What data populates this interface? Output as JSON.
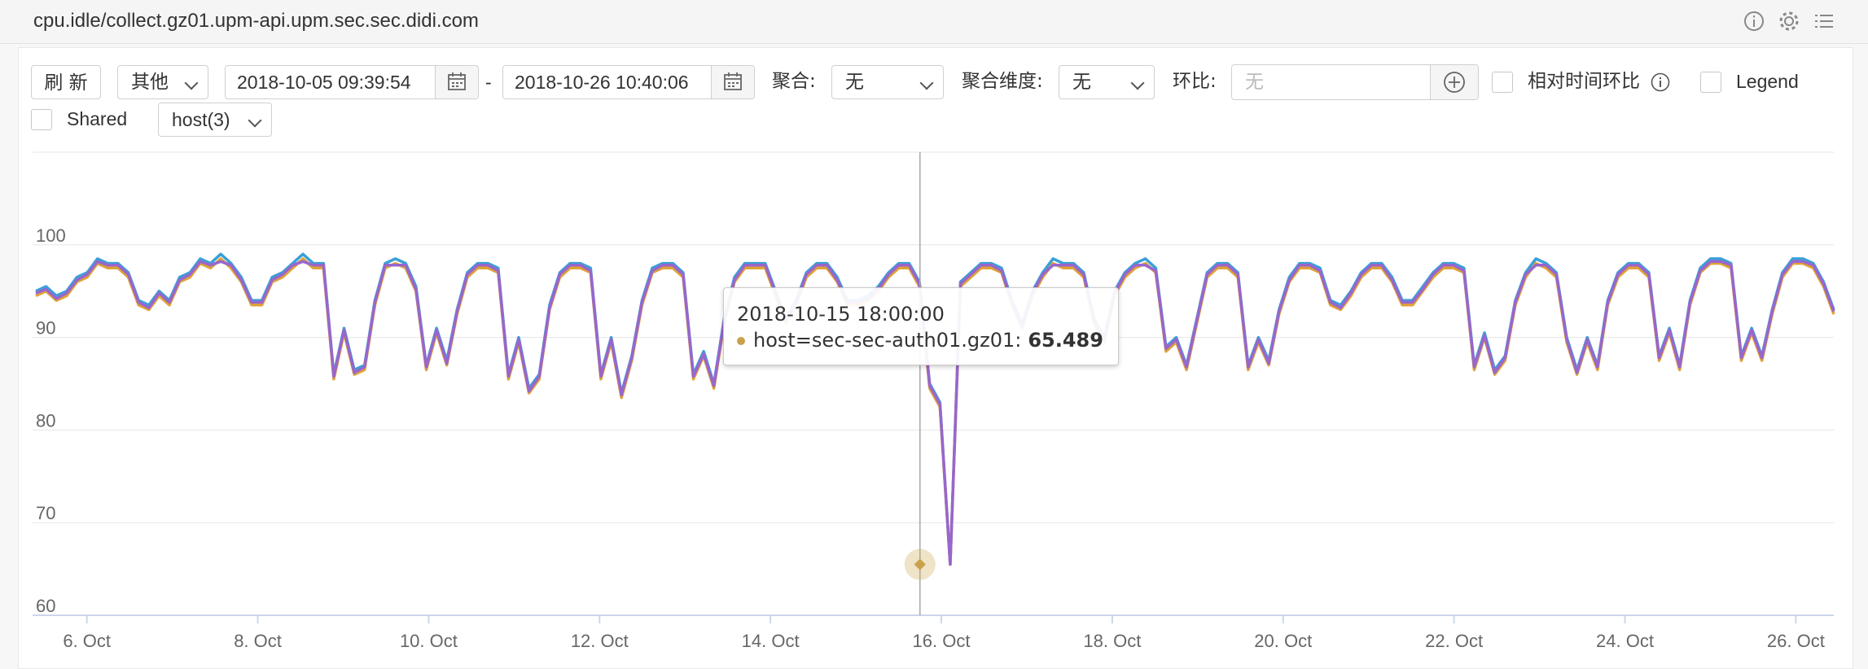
{
  "header": {
    "title": "cpu.idle/collect.gz01.upm-api.upm.sec.sec.didi.com",
    "icons": [
      "info-icon",
      "gear-icon",
      "list-icon"
    ]
  },
  "toolbar": {
    "refresh_label": "刷 新",
    "other_label": "其他",
    "start_date": "2018-10-05 09:39:54",
    "dash": "-",
    "end_date": "2018-10-26 10:40:06",
    "aggregate_label": "聚合:",
    "aggregate_value": "无",
    "dimension_label": "聚合维度:",
    "dimension_value": "无",
    "compare_label": "环比:",
    "compare_placeholder": "无",
    "relative_label": "相对时间环比",
    "legend_label": "Legend",
    "shared_label": "Shared",
    "host_value": "host(3)"
  },
  "tooltip": {
    "time": "2018-10-15 18:00:00",
    "series": "host=sec-sec-auth01.gz01:",
    "value": "65.489",
    "color": "#c9a14a"
  },
  "chart_data": {
    "type": "line",
    "xlabel": "",
    "ylabel": "",
    "ylim": [
      60,
      110
    ],
    "y_ticks": [
      60,
      70,
      80,
      90,
      100
    ],
    "x_range": [
      "2018-10-05 09:39:54",
      "2018-10-26 10:40:06"
    ],
    "x_ticks": [
      "6. Oct",
      "8. Oct",
      "10. Oct",
      "12. Oct",
      "14. Oct",
      "16. Oct",
      "18. Oct",
      "20. Oct",
      "22. Oct",
      "24. Oct",
      "26. Oct"
    ],
    "grid": true,
    "legend": "hidden",
    "colors": [
      "#3aa0d8",
      "#e0a236",
      "#9966cc"
    ],
    "series": [
      {
        "values": [
          95,
          95.5,
          94.5,
          95,
          96.5,
          97,
          98.5,
          98,
          98,
          97,
          94,
          93.5,
          95,
          94,
          96.5,
          97,
          98.5,
          98,
          99,
          98,
          96.5,
          94,
          94,
          96.5,
          97,
          98,
          99,
          98,
          98,
          86,
          91,
          86.5,
          87,
          94,
          98,
          98.5,
          98,
          95.5,
          87,
          91,
          87.5,
          93,
          97,
          98,
          98,
          97.5,
          86,
          90,
          84.5,
          86,
          93.5,
          97,
          98,
          98,
          97.5,
          86,
          90,
          84,
          88,
          94,
          97.5,
          98,
          98,
          97,
          86,
          88.5,
          85,
          92,
          96.5,
          98,
          98,
          98,
          95,
          92,
          94,
          97,
          98,
          98,
          96.5,
          94,
          94,
          94.5,
          95.5,
          97,
          98,
          98,
          96,
          85,
          83,
          65.5,
          96,
          97,
          98,
          98,
          97.5,
          94,
          91.5,
          95,
          97,
          98.5,
          98,
          98,
          97,
          92,
          90,
          95,
          97,
          98,
          98.5,
          97.5,
          89,
          90,
          87,
          92,
          97,
          98,
          98,
          97,
          87,
          90,
          87.5,
          93,
          96.5,
          98,
          98,
          97.5,
          94,
          93.5,
          95,
          97,
          98,
          98,
          96.5,
          94,
          94,
          95.5,
          97,
          98,
          98,
          97.5,
          87,
          90.5,
          86.5,
          88,
          94,
          97,
          98.5,
          98,
          97,
          90,
          86.5,
          90,
          87,
          94,
          97,
          98,
          98,
          97,
          88,
          91,
          87,
          94,
          97.5,
          98.5,
          98.5,
          98,
          88,
          91,
          88,
          93,
          97,
          98.5,
          98.5,
          98,
          96,
          93
        ]
      },
      {
        "values": [
          94.5,
          95,
          94,
          94.5,
          96,
          96.5,
          98,
          97.5,
          97.5,
          96.5,
          93.5,
          93,
          94.5,
          93.5,
          96,
          96.5,
          98,
          97.5,
          98.5,
          97.5,
          96,
          93.5,
          93.5,
          96,
          96.5,
          97.5,
          98.5,
          97.5,
          97.5,
          85.5,
          90.5,
          86,
          86.5,
          93.5,
          97.5,
          98,
          97.5,
          95,
          86.5,
          90.5,
          87,
          92.5,
          96.5,
          97.5,
          97.5,
          97,
          85.5,
          89.5,
          84,
          85.5,
          93,
          96.5,
          97.5,
          97.5,
          97,
          85.5,
          89.5,
          83.5,
          87.5,
          93.5,
          97,
          97.5,
          97.5,
          96.5,
          85.5,
          88,
          84.5,
          91.5,
          96,
          97.5,
          97.5,
          97.5,
          94.5,
          91.5,
          93.5,
          96.5,
          97.5,
          97.5,
          96,
          93.5,
          93.5,
          94,
          95,
          96.5,
          97.5,
          97.5,
          95.5,
          84.5,
          82.5,
          65.5,
          95.5,
          96.5,
          97.5,
          97.5,
          97,
          93.5,
          91,
          94.5,
          96.5,
          98,
          97.5,
          97.5,
          96.5,
          91.5,
          89.5,
          94.5,
          96.5,
          97.5,
          98,
          97,
          88.5,
          89.5,
          86.5,
          91.5,
          96.5,
          97.5,
          97.5,
          96.5,
          86.5,
          89.5,
          87,
          92.5,
          96,
          97.5,
          97.5,
          97,
          93.5,
          93,
          94.5,
          96.5,
          97.5,
          97.5,
          96,
          93.5,
          93.5,
          95,
          96.5,
          97.5,
          97.5,
          97,
          86.5,
          90,
          86,
          87.5,
          93.5,
          96.5,
          98,
          97.5,
          96.5,
          89.5,
          86,
          89.5,
          86.5,
          93.5,
          96.5,
          97.5,
          97.5,
          96.5,
          87.5,
          90.5,
          86.5,
          93.5,
          97,
          98,
          98,
          97.5,
          87.5,
          90.5,
          87.5,
          92.5,
          96.5,
          98,
          98,
          97.5,
          95.5,
          92.5
        ]
      },
      {
        "values": [
          94.8,
          95.2,
          94.2,
          94.8,
          96.2,
          96.8,
          98.2,
          97.8,
          97.8,
          96.8,
          93.8,
          93.2,
          94.8,
          93.8,
          96.2,
          96.8,
          98.2,
          97.8,
          98.2,
          97.8,
          96.2,
          93.8,
          93.8,
          96.2,
          96.8,
          97.8,
          98.2,
          97.8,
          97.8,
          85.8,
          90.8,
          86.2,
          86.8,
          93.8,
          97.8,
          97.8,
          97.8,
          95.2,
          86.8,
          90.8,
          87.2,
          92.8,
          96.8,
          97.8,
          97.8,
          97.2,
          85.8,
          89.8,
          84.2,
          85.8,
          93.2,
          96.8,
          97.8,
          97.8,
          97.2,
          85.8,
          89.8,
          83.8,
          87.8,
          93.8,
          97.2,
          97.8,
          97.8,
          96.8,
          85.8,
          88.2,
          84.8,
          91.8,
          96.2,
          97.8,
          97.8,
          97.8,
          94.8,
          91.8,
          93.8,
          96.8,
          97.8,
          97.8,
          96.2,
          93.8,
          93.8,
          94.2,
          95.2,
          96.8,
          97.8,
          97.8,
          95.8,
          84.8,
          82.8,
          65.5,
          95.8,
          96.8,
          97.8,
          97.8,
          97.2,
          93.8,
          91.2,
          94.8,
          96.8,
          97.8,
          97.8,
          97.8,
          96.8,
          91.8,
          89.8,
          94.8,
          96.8,
          97.8,
          97.8,
          97.2,
          88.8,
          89.8,
          86.8,
          91.8,
          96.8,
          97.8,
          97.8,
          96.8,
          86.8,
          89.8,
          87.2,
          92.8,
          96.2,
          97.8,
          97.8,
          97.2,
          93.8,
          93.2,
          94.8,
          96.8,
          97.8,
          97.8,
          96.2,
          93.8,
          93.8,
          95.2,
          96.8,
          97.8,
          97.8,
          97.2,
          86.8,
          90.2,
          86.2,
          87.8,
          93.8,
          96.8,
          97.8,
          97.8,
          96.8,
          89.8,
          86.2,
          89.8,
          86.8,
          93.8,
          96.8,
          97.8,
          97.8,
          96.8,
          87.8,
          90.8,
          86.8,
          93.8,
          97.2,
          98.2,
          98.2,
          97.8,
          87.8,
          90.8,
          87.8,
          92.8,
          96.8,
          98.2,
          98.2,
          97.8,
          95.8,
          92.8
        ]
      }
    ]
  }
}
